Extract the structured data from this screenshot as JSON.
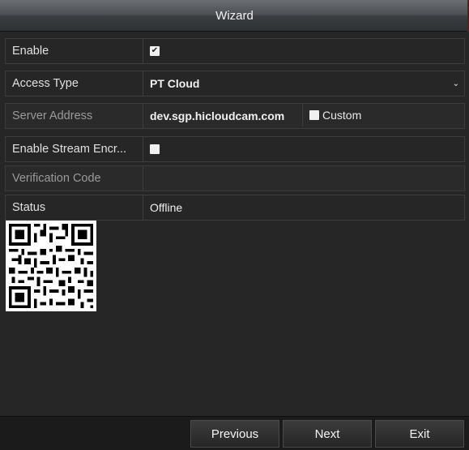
{
  "window": {
    "title": "Wizard"
  },
  "fields": {
    "enable": {
      "label": "Enable",
      "checked": true
    },
    "access_type": {
      "label": "Access Type",
      "value": "PT Cloud"
    },
    "server_address": {
      "label": "Server Address",
      "value": "dev.sgp.hicloudcam.com",
      "custom_label": "Custom"
    },
    "enable_stream_encryption": {
      "label": "Enable Stream Encr...",
      "checked": false
    },
    "verification_code": {
      "label": "Verification Code",
      "value": ""
    },
    "status": {
      "label": "Status",
      "value": "Offline"
    }
  },
  "qr": {
    "icon": "qr-code"
  },
  "footer": {
    "previous_label": "Previous",
    "next_label": "Next",
    "exit_label": "Exit"
  },
  "colors": {
    "background": "#262626",
    "titlebar": "#4b4f54",
    "border": "#3d3d3d",
    "text": "#e8e8e8"
  }
}
